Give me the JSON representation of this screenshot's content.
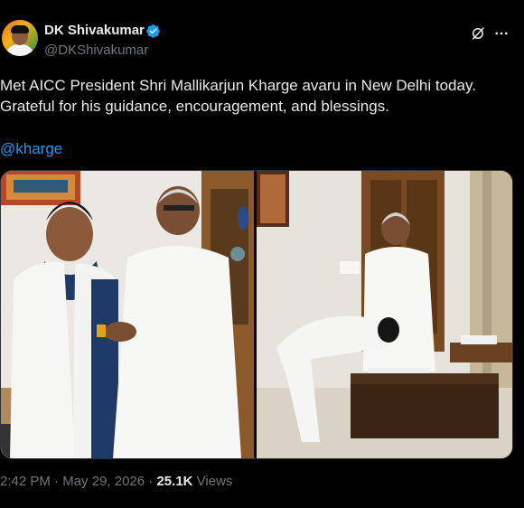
{
  "author": {
    "display_name": "DK Shivakumar",
    "handle": "@DKShivakumar",
    "verified": true,
    "verified_color": "#1d9bf0"
  },
  "tweet": {
    "line1": "Met AICC President Shri Mallikarjun Kharge avaru in New Delhi today.",
    "line2": "Grateful for his guidance, encouragement, and blessings.",
    "mention": "@kharge"
  },
  "media": {
    "image_count": 2
  },
  "meta": {
    "time": "2:42 PM",
    "separator": "·",
    "date": "May 29, 2026",
    "views_count": "25.1K",
    "views_label": "Views"
  },
  "colors": {
    "background": "#000000",
    "text": "#e7e9ea",
    "secondary": "#71767b",
    "link": "#1d9bf0"
  },
  "icons": {
    "grok": "grok-icon",
    "more": "more-icon",
    "verified": "verified-icon"
  }
}
